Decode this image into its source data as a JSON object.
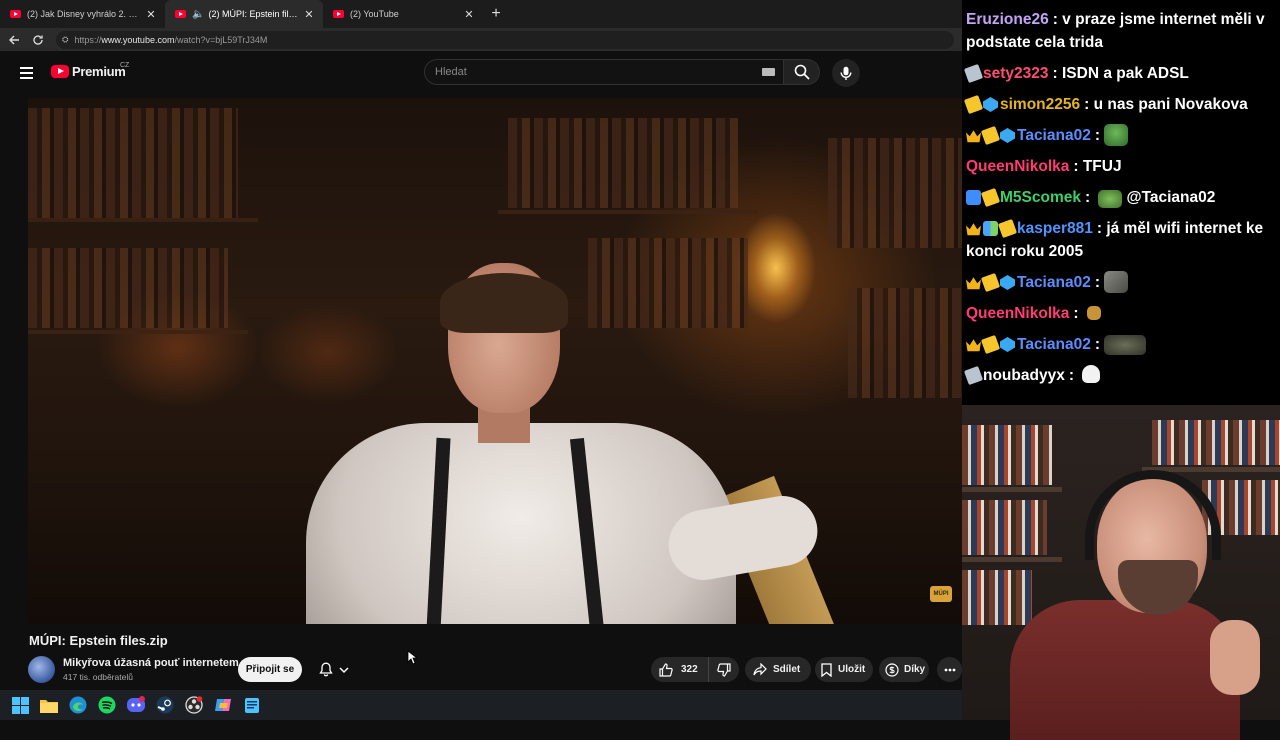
{
  "browser": {
    "tabs": [
      {
        "label": "(2) Jak Disney vyhrálo 2. světovou",
        "active": false
      },
      {
        "label": "(2) MÚPI: Epstein files.zip - YouTube",
        "active": true,
        "audio": true
      },
      {
        "label": "(2) YouTube",
        "active": false
      }
    ],
    "url_prefix": "https://",
    "url_host": "www.youtube.com",
    "url_path": "/watch?v=bjL59TrJ34M"
  },
  "youtube": {
    "logo_text": "Premium",
    "country_code": "CZ",
    "search_placeholder": "Hledat"
  },
  "video": {
    "title": "MÚPI: Epstein files.zip",
    "channel_name": "Mikyřova úžasná pouť internetem",
    "subscribers": "417 tis. odběratelů",
    "join_label": "Připojit se",
    "like_count": "322",
    "share_label": "Sdílet",
    "save_label": "Uložit",
    "thanks_label": "Díky",
    "watermark_text": "MÚPI"
  },
  "chat": {
    "messages": [
      {
        "user": "Eruzione26",
        "color": "#c3a4f7",
        "badges": [],
        "text": "v praze jsme internet měli v podstate cela trida"
      },
      {
        "user": "sety2323",
        "color": "#ff4d6d",
        "badges": [
          "silver"
        ],
        "text": "ISDN a pak ADSL"
      },
      {
        "user": "simon2256",
        "color": "#e6b422",
        "badges": [
          "bolt",
          "gem"
        ],
        "text": "u nas pani Novakova"
      },
      {
        "user": "Taciana02",
        "color": "#5b8dff",
        "badges": [
          "crown",
          "bolt",
          "gem"
        ],
        "text": "",
        "emote": "pepe"
      },
      {
        "user": "QueenNikolka",
        "color": "#ff3b73",
        "badges": [],
        "text": "TFUJ"
      },
      {
        "user": "M5Scomek",
        "color": "#3fcf6a",
        "badges": [
          "arrow",
          "bolt"
        ],
        "text": "@Taciana02",
        "emote": "turtle"
      },
      {
        "user": "kasper881",
        "color": "#4f93ff",
        "badges": [
          "crown",
          "split",
          "bolt"
        ],
        "text": "já měl wifi internet ke konci roku 2005"
      },
      {
        "user": "Taciana02",
        "color": "#5b8dff",
        "badges": [
          "crown",
          "bolt",
          "gem"
        ],
        "text": "",
        "emote": "photo"
      },
      {
        "user": "QueenNikolka",
        "color": "#ff3b73",
        "badges": [],
        "text": "",
        "emote": "small"
      },
      {
        "user": "Taciana02",
        "color": "#5b8dff",
        "badges": [
          "crown",
          "bolt",
          "gem"
        ],
        "text": "",
        "emote": "wide"
      },
      {
        "user": "noubadyyx",
        "color": "#ffffff",
        "badges": [
          "silver"
        ],
        "text": "",
        "emote": "skull"
      }
    ]
  },
  "taskbar": {
    "icons": [
      "windows-start-icon",
      "file-explorer-icon",
      "edge-icon",
      "spotify-icon",
      "discord-icon",
      "steam-icon",
      "obs-icon",
      "copilot-icon",
      "notepad-icon"
    ]
  }
}
